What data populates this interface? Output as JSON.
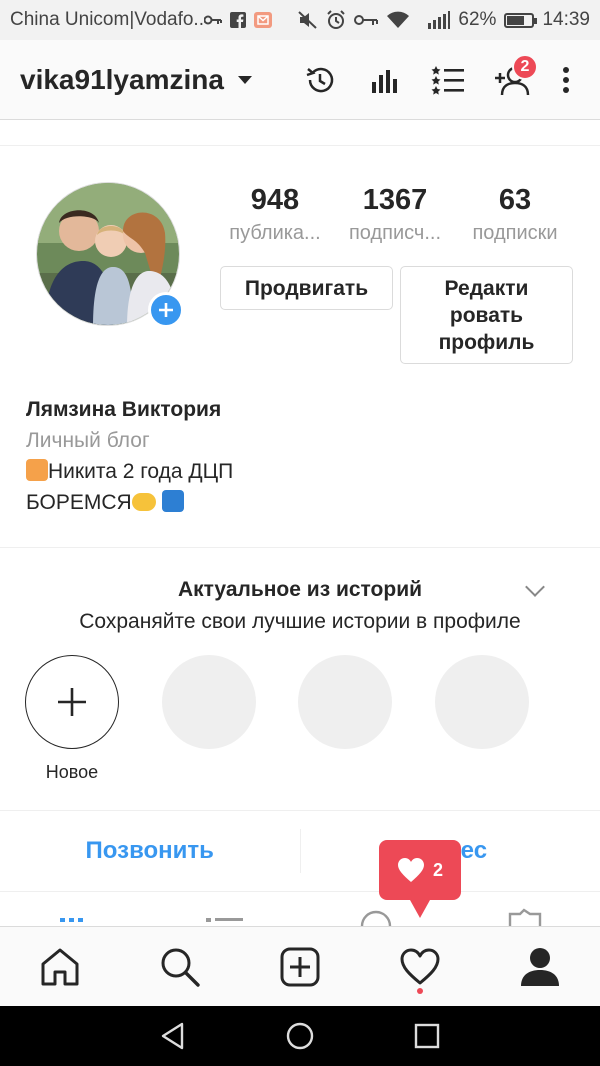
{
  "status_bar": {
    "carrier": "China Unicom|Vodafo...",
    "battery": "62%",
    "time": "14:39"
  },
  "header": {
    "username": "vika91lyamzina",
    "notification_count": "2"
  },
  "profile": {
    "stats": [
      {
        "value": "948",
        "label": "публика..."
      },
      {
        "value": "1367",
        "label": "подписч..."
      },
      {
        "value": "63",
        "label": "подписки"
      }
    ],
    "promote_label": "Продвигать",
    "edit_label": "Редакти ровать профиль",
    "name": "Лямзина Виктория",
    "category": "Личный блог",
    "bio_line1": "Никита 2 года ДЦП",
    "bio_line2": "БОРЕМСЯ"
  },
  "highlights": {
    "title": "Актуальное из историй",
    "subtitle": "Сохраняйте свои лучшие истории в профиле",
    "new_label": "Новое"
  },
  "contact": {
    "call": "Позвонить",
    "address": "Адрес"
  },
  "like_tip": {
    "count": "2"
  },
  "colors": {
    "accent_blue": "#3897f0",
    "notification_red": "#ed4956",
    "text": "#262626",
    "secondary_text": "#999999"
  },
  "icons": [
    "key-icon",
    "facebook-icon",
    "mail-icon",
    "mute-icon",
    "alarm-icon",
    "wifi-icon",
    "signal-icon",
    "battery-icon",
    "history-icon",
    "insights-icon",
    "saved-list-icon",
    "add-user-icon",
    "more-icon",
    "home-icon",
    "search-icon",
    "add-post-icon",
    "heart-icon",
    "profile-icon",
    "back-icon",
    "home-circle-icon",
    "recent-apps-icon"
  ]
}
